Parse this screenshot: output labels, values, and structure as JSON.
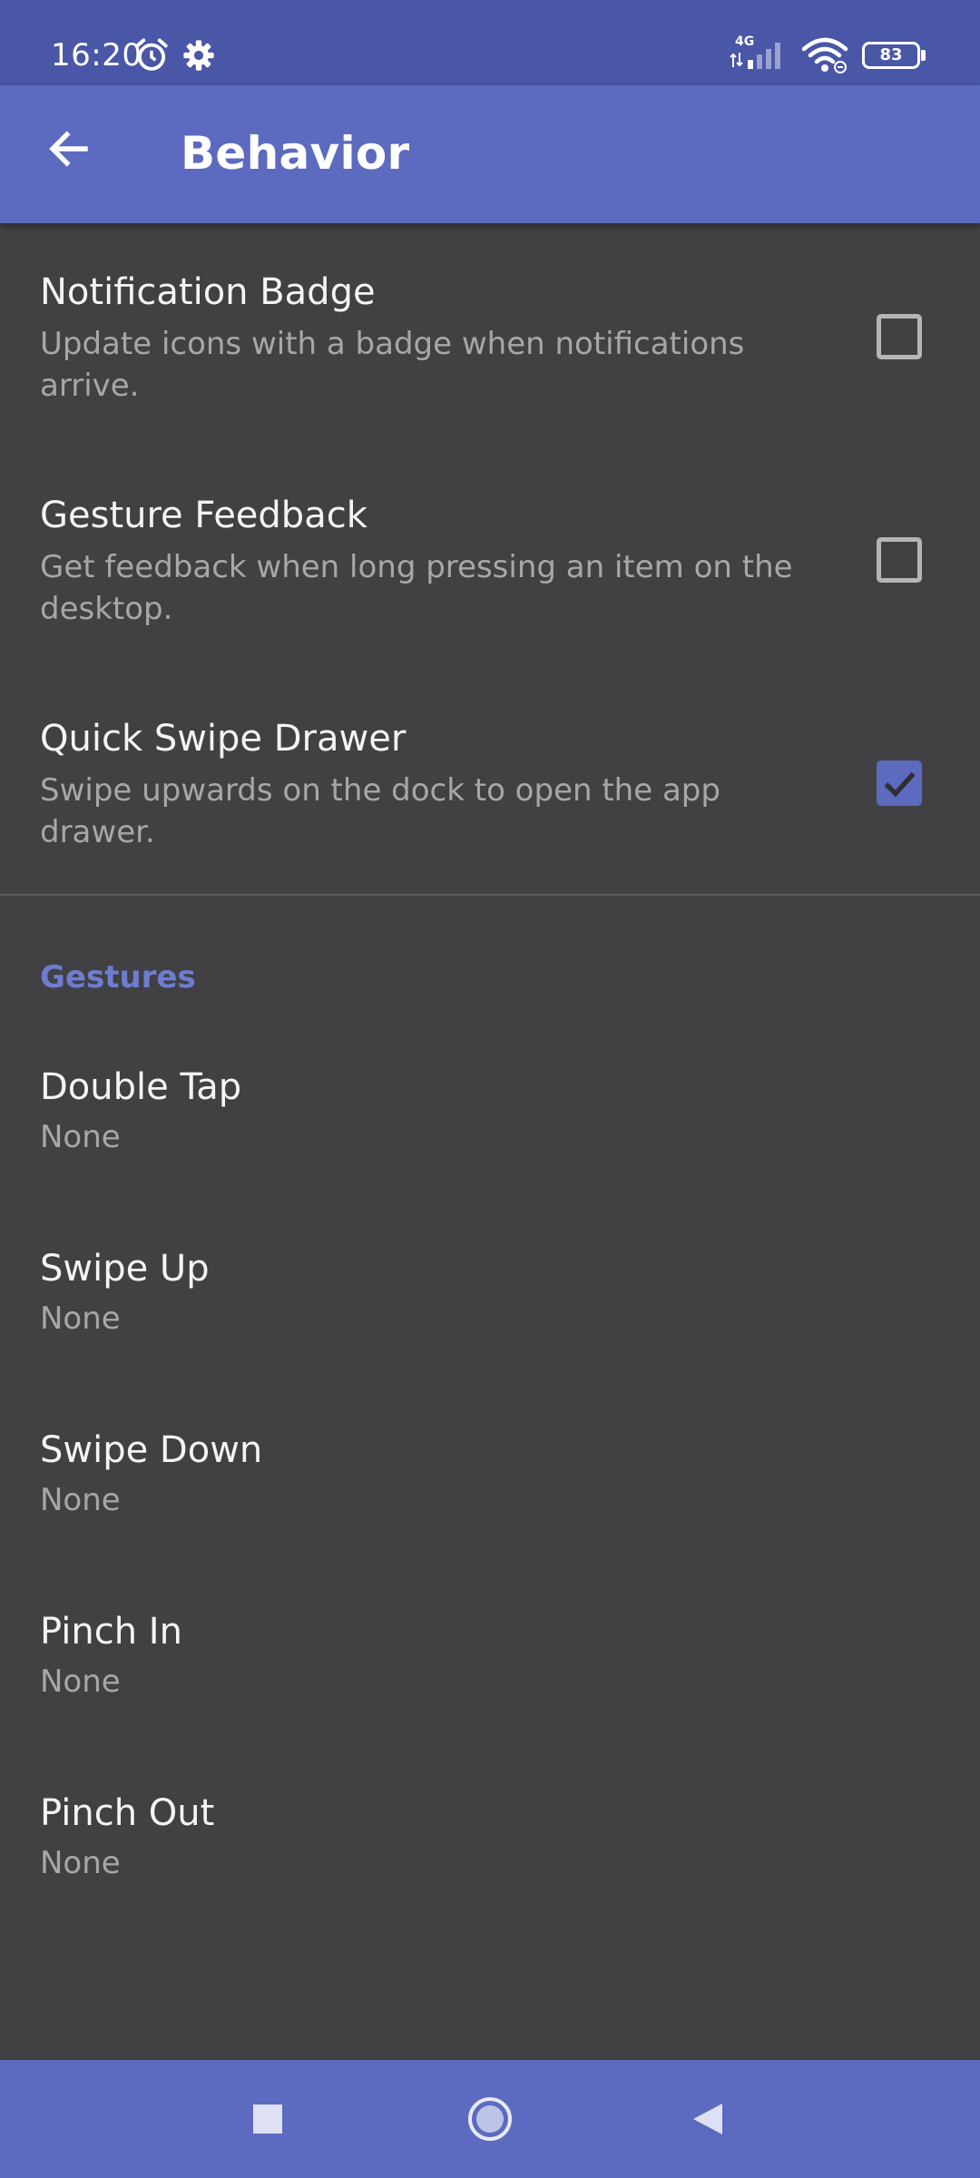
{
  "status_bar": {
    "time": "16:20",
    "alarm_icon": "alarm-clock-icon",
    "settings_icon": "gear-icon",
    "network_type": "4G",
    "battery_level": "83"
  },
  "app_bar": {
    "back_icon": "arrow-left-icon",
    "title": "Behavior"
  },
  "behavior": [
    {
      "title": "Notification Badge",
      "summary": "Update icons with a badge when notifications arrive.",
      "checked": false
    },
    {
      "title": "Gesture Feedback",
      "summary": "Get feedback when long pressing an item on the desktop.",
      "checked": false
    },
    {
      "title": "Quick Swipe Drawer",
      "summary": "Swipe upwards on the dock to open the app drawer.",
      "checked": true
    }
  ],
  "gestures": {
    "header": "Gestures",
    "items": [
      {
        "title": "Double Tap",
        "value": "None"
      },
      {
        "title": "Swipe Up",
        "value": "None"
      },
      {
        "title": "Swipe Down",
        "value": "None"
      },
      {
        "title": "Pinch In",
        "value": "None"
      },
      {
        "title": "Pinch Out",
        "value": "None"
      }
    ]
  },
  "colors": {
    "primary": "#5c6bc0",
    "status_bar": "#4a56a6",
    "background": "#414042",
    "accent_text": "#6e7dd1"
  },
  "nav_bar": {
    "recents_icon": "square-recents-icon",
    "home_icon": "circle-home-icon",
    "back_icon": "triangle-back-icon"
  }
}
